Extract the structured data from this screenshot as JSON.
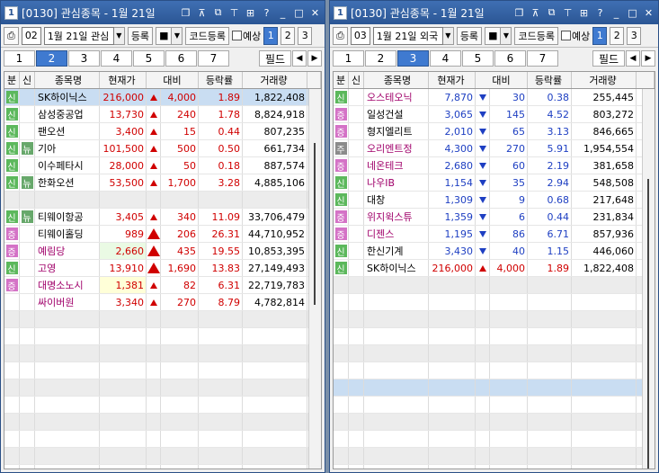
{
  "windows": [
    {
      "id": "win1",
      "title_num": "1",
      "title": "[0130] 관심종목 - 1월 21일",
      "toolbar": {
        "group": "02",
        "date": "1월 21일 관심",
        "register": "등록",
        "code_register": "코드등록",
        "forecast": "예상",
        "pages": [
          "1",
          "2",
          "3"
        ],
        "active_page": 0
      },
      "tabs": [
        "1",
        "2",
        "3",
        "4",
        "5",
        "6",
        "7"
      ],
      "active_tab": 1,
      "field_label": "필드",
      "headers": {
        "bun": "분",
        "sin": "신",
        "name": "종목명",
        "price": "현재가",
        "diff": "대비",
        "rate": "등락률",
        "vol": "거래량"
      },
      "rows": [
        {
          "bun": "신",
          "bun_type": "sin",
          "sin": "",
          "name": "SK하이닉스",
          "price": "216,000",
          "dir": "up",
          "diff": "4,000",
          "rate": "1.89",
          "vol": "1,822,408",
          "color": "red",
          "name_color": "black",
          "row": "sel"
        },
        {
          "bun": "신",
          "bun_type": "sin",
          "sin": "",
          "name": "삼성중공업",
          "price": "13,730",
          "dir": "up",
          "diff": "240",
          "rate": "1.78",
          "vol": "8,824,918",
          "color": "red",
          "name_color": "black"
        },
        {
          "bun": "신",
          "bun_type": "sin",
          "sin": "",
          "name": "팬오션",
          "price": "3,400",
          "dir": "up",
          "diff": "15",
          "rate": "0.44",
          "vol": "807,235",
          "color": "red",
          "name_color": "black"
        },
        {
          "bun": "신",
          "bun_type": "sin",
          "sin": "뉴",
          "name": "기아",
          "price": "101,500",
          "dir": "up",
          "diff": "500",
          "rate": "0.50",
          "vol": "661,734",
          "color": "red",
          "name_color": "black"
        },
        {
          "bun": "신",
          "bun_type": "sin",
          "sin": "",
          "name": "이수페타시",
          "price": "28,000",
          "dir": "up",
          "diff": "50",
          "rate": "0.18",
          "vol": "887,574",
          "color": "red",
          "name_color": "black"
        },
        {
          "bun": "신",
          "bun_type": "sin",
          "sin": "뉴",
          "name": "한화오션",
          "price": "53,500",
          "dir": "up",
          "diff": "1,700",
          "rate": "3.28",
          "vol": "4,885,106",
          "color": "red",
          "name_color": "black"
        },
        {
          "empty": true,
          "row": "gray"
        },
        {
          "bun": "신",
          "bun_type": "sin",
          "sin": "뉴",
          "name": "티웨이항공",
          "price": "3,405",
          "dir": "up",
          "diff": "340",
          "rate": "11.09",
          "vol": "33,706,479",
          "color": "red",
          "name_color": "black"
        },
        {
          "bun": "증",
          "bun_type": "jeung",
          "sin": "",
          "name": "티웨이홀딩",
          "price": "989",
          "dir": "upbig",
          "diff": "206",
          "rate": "26.31",
          "vol": "44,710,952",
          "color": "red",
          "name_color": "black"
        },
        {
          "bun": "증",
          "bun_type": "jeung",
          "sin": "",
          "name": "예림당",
          "price": "2,660",
          "dir": "upbig",
          "diff": "435",
          "rate": "19.55",
          "vol": "10,853,395",
          "color": "red",
          "name_color": "purple",
          "price_bg": "pale-green"
        },
        {
          "bun": "신",
          "bun_type": "sin",
          "sin": "",
          "name": "고영",
          "price": "13,910",
          "dir": "upbig",
          "diff": "1,690",
          "rate": "13.83",
          "vol": "27,149,493",
          "color": "red",
          "name_color": "purple"
        },
        {
          "bun": "증",
          "bun_type": "jeung",
          "sin": "",
          "name": "대명소노시",
          "price": "1,381",
          "dir": "up",
          "diff": "82",
          "rate": "6.31",
          "vol": "22,719,783",
          "color": "red",
          "name_color": "purple",
          "price_bg": "pale-yellow"
        },
        {
          "bun": "",
          "bun_type": "",
          "sin": "",
          "name": "싸이버원",
          "price": "3,340",
          "dir": "up",
          "diff": "270",
          "rate": "8.79",
          "vol": "4,782,814",
          "color": "red",
          "name_color": "purple"
        },
        {
          "empty": true,
          "row": "gray"
        },
        {
          "empty": true
        },
        {
          "empty": true,
          "row": "gray"
        },
        {
          "empty": true
        },
        {
          "empty": true,
          "row": "gray"
        },
        {
          "empty": true
        },
        {
          "empty": true,
          "row": "gray"
        },
        {
          "empty": true
        },
        {
          "empty": true,
          "row": "gray"
        },
        {
          "empty": true
        }
      ]
    },
    {
      "id": "win2",
      "title_num": "1",
      "title": "[0130] 관심종목 - 1월 21일",
      "toolbar": {
        "group": "03",
        "date": "1월 21일 외국",
        "register": "등록",
        "code_register": "코드등록",
        "forecast": "예상",
        "pages": [
          "1",
          "2",
          "3"
        ],
        "active_page": 0
      },
      "tabs": [
        "1",
        "2",
        "3",
        "4",
        "5",
        "6",
        "7"
      ],
      "active_tab": 2,
      "field_label": "필드",
      "headers": {
        "bun": "분",
        "sin": "신",
        "name": "종목명",
        "price": "현재가",
        "diff": "대비",
        "rate": "등락률",
        "vol": "거래량"
      },
      "rows": [
        {
          "bun": "신",
          "bun_type": "sin",
          "sin": "",
          "name": "오스테오닉",
          "price": "7,870",
          "dir": "down",
          "diff": "30",
          "rate": "0.38",
          "vol": "255,445",
          "color": "blue-t",
          "name_color": "purple"
        },
        {
          "bun": "증",
          "bun_type": "jeung",
          "sin": "",
          "name": "일성건설",
          "price": "3,065",
          "dir": "down",
          "diff": "145",
          "rate": "4.52",
          "vol": "803,272",
          "color": "blue-t",
          "name_color": "black"
        },
        {
          "bun": "증",
          "bun_type": "jeung",
          "sin": "",
          "name": "형지엘리트",
          "price": "2,010",
          "dir": "down",
          "diff": "65",
          "rate": "3.13",
          "vol": "846,665",
          "color": "blue-t",
          "name_color": "black"
        },
        {
          "bun": "주",
          "bun_type": "gwan",
          "sin": "",
          "name": "오리엔트정",
          "price": "4,300",
          "dir": "down",
          "diff": "270",
          "rate": "5.91",
          "vol": "1,954,554",
          "color": "blue-t",
          "name_color": "purple"
        },
        {
          "bun": "증",
          "bun_type": "jeung",
          "sin": "",
          "name": "네온테크",
          "price": "2,680",
          "dir": "down",
          "diff": "60",
          "rate": "2.19",
          "vol": "381,658",
          "color": "blue-t",
          "name_color": "purple"
        },
        {
          "bun": "신",
          "bun_type": "sin",
          "sin": "",
          "name": "나우IB",
          "price": "1,154",
          "dir": "down",
          "diff": "35",
          "rate": "2.94",
          "vol": "548,508",
          "color": "blue-t",
          "name_color": "purple"
        },
        {
          "bun": "신",
          "bun_type": "sin",
          "sin": "",
          "name": "대창",
          "price": "1,309",
          "dir": "down",
          "diff": "9",
          "rate": "0.68",
          "vol": "217,648",
          "color": "blue-t",
          "name_color": "black"
        },
        {
          "bun": "증",
          "bun_type": "jeung",
          "sin": "",
          "name": "위지윅스튜",
          "price": "1,359",
          "dir": "down",
          "diff": "6",
          "rate": "0.44",
          "vol": "231,834",
          "color": "blue-t",
          "name_color": "purple"
        },
        {
          "bun": "증",
          "bun_type": "jeung",
          "sin": "",
          "name": "디젠스",
          "price": "1,195",
          "dir": "down",
          "diff": "86",
          "rate": "6.71",
          "vol": "857,936",
          "color": "blue-t",
          "name_color": "purple"
        },
        {
          "bun": "신",
          "bun_type": "sin",
          "sin": "",
          "name": "한신기계",
          "price": "3,430",
          "dir": "down",
          "diff": "40",
          "rate": "1.15",
          "vol": "446,060",
          "color": "blue-t",
          "name_color": "black"
        },
        {
          "bun": "신",
          "bun_type": "sin",
          "sin": "",
          "name": "SK하이닉스",
          "price": "216,000",
          "dir": "up",
          "diff": "4,000",
          "rate": "1.89",
          "vol": "1,822,408",
          "color": "red",
          "name_color": "black"
        },
        {
          "empty": true,
          "row": "gray"
        },
        {
          "empty": true
        },
        {
          "empty": true,
          "row": "gray"
        },
        {
          "empty": true
        },
        {
          "empty": true,
          "row": "gray"
        },
        {
          "empty": true
        },
        {
          "empty": true,
          "row": "blue"
        },
        {
          "empty": true
        },
        {
          "empty": true,
          "row": "gray"
        },
        {
          "empty": true
        },
        {
          "empty": true,
          "row": "gray"
        },
        {
          "empty": true
        }
      ]
    }
  ],
  "icons": {
    "title_icons": [
      "restore-icon",
      "pin-icon",
      "copy-icon",
      "filter-icon",
      "grid-icon",
      "help-icon",
      "minimize-icon",
      "maximize-icon",
      "close-icon"
    ]
  }
}
